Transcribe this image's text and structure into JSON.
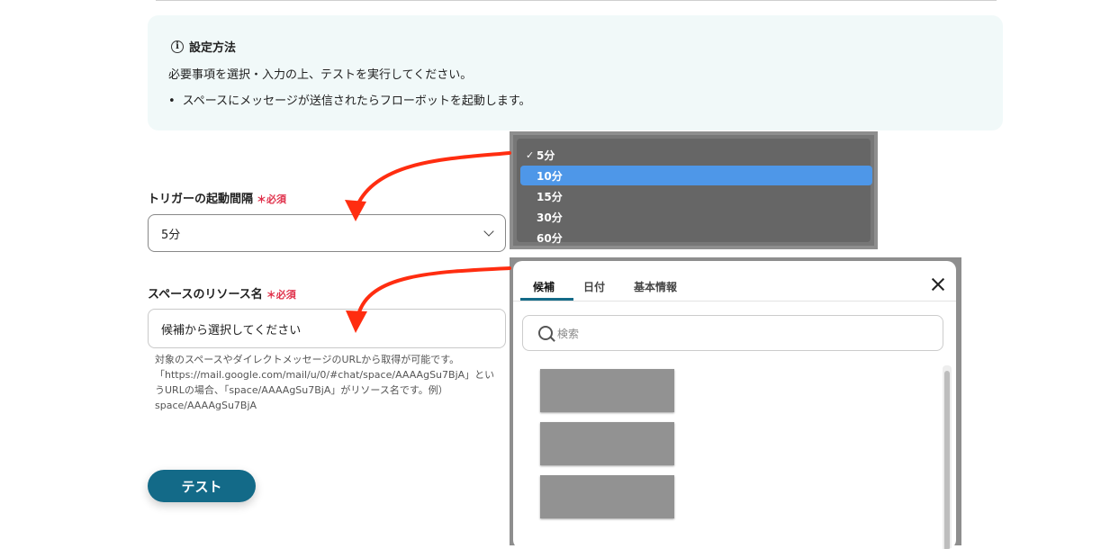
{
  "info": {
    "title": "設定方法",
    "line": "必要事項を選択・入力の上、テストを実行してください。",
    "bullet": "スペースにメッセージが送信されたらフローボットを起動します。"
  },
  "trigger": {
    "label": "トリガーの起動間隔",
    "required": "＊必須",
    "value": "5分"
  },
  "resource": {
    "label": "スペースのリソース名",
    "required": "＊必須",
    "placeholder": "候補から選択してください",
    "help": [
      "対象のスペースやダイレクトメッセージのURLから取得が可能です。",
      "「https://mail.google.com/mail/u/0/#chat/space/AAAAgSu7BjA」とい",
      "うURLの場合、「space/AAAAgSu7BjA」がリソース名です。例）",
      "space/AAAAgSu7BjA"
    ]
  },
  "test_button": "テスト",
  "dropdown": {
    "check": "✓",
    "options": [
      "5分",
      "10分",
      "15分",
      "30分",
      "60分"
    ],
    "selected_index": 0,
    "highlighted_index": 1
  },
  "panel": {
    "tabs": [
      "候補",
      "日付",
      "基本情報"
    ],
    "active_tab": 0,
    "search_placeholder": "検索"
  },
  "colors": {
    "accent": "#136a88",
    "required": "#e0304a",
    "arrow": "#ff2d10",
    "highlight": "#4e97e8"
  }
}
